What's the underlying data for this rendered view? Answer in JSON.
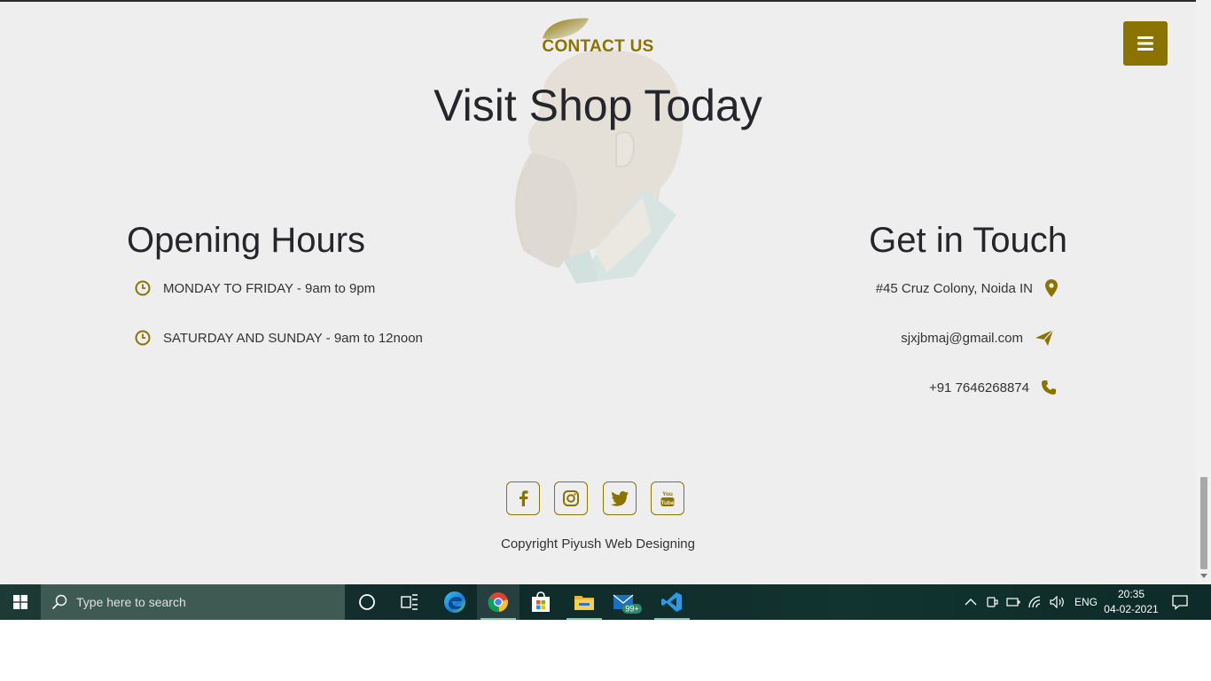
{
  "contact": {
    "eyebrow": "CONTACT US",
    "headline": "Visit Shop Today"
  },
  "opening_hours": {
    "title": "Opening Hours",
    "rows": [
      {
        "text": "MONDAY TO FRIDAY - 9am to 9pm",
        "icon": "clock-icon"
      },
      {
        "text": "SATURDAY AND SUNDAY - 9am to 12noon",
        "icon": "clock-icon"
      }
    ]
  },
  "get_in_touch": {
    "title": "Get in Touch",
    "rows": [
      {
        "text": "#45 Cruz Colony, Noida IN",
        "icon": "map-marker-icon"
      },
      {
        "text": "sjxjbmaj@gmail.com",
        "icon": "paper-plane-icon"
      },
      {
        "text": "+91 7646268874",
        "icon": "phone-icon"
      }
    ]
  },
  "social": [
    "facebook-icon",
    "instagram-icon",
    "twitter-icon",
    "youtube-icon"
  ],
  "copyright": "Copyright Piyush Web Designing",
  "taskbar": {
    "search_placeholder": "Type here to search",
    "mail_badge": "99+",
    "language": "ENG",
    "time": "20:35",
    "date": "04-02-2021"
  },
  "colors": {
    "accent": "#8a7300",
    "page_bg": "#efeeee",
    "heading": "#25262b"
  }
}
